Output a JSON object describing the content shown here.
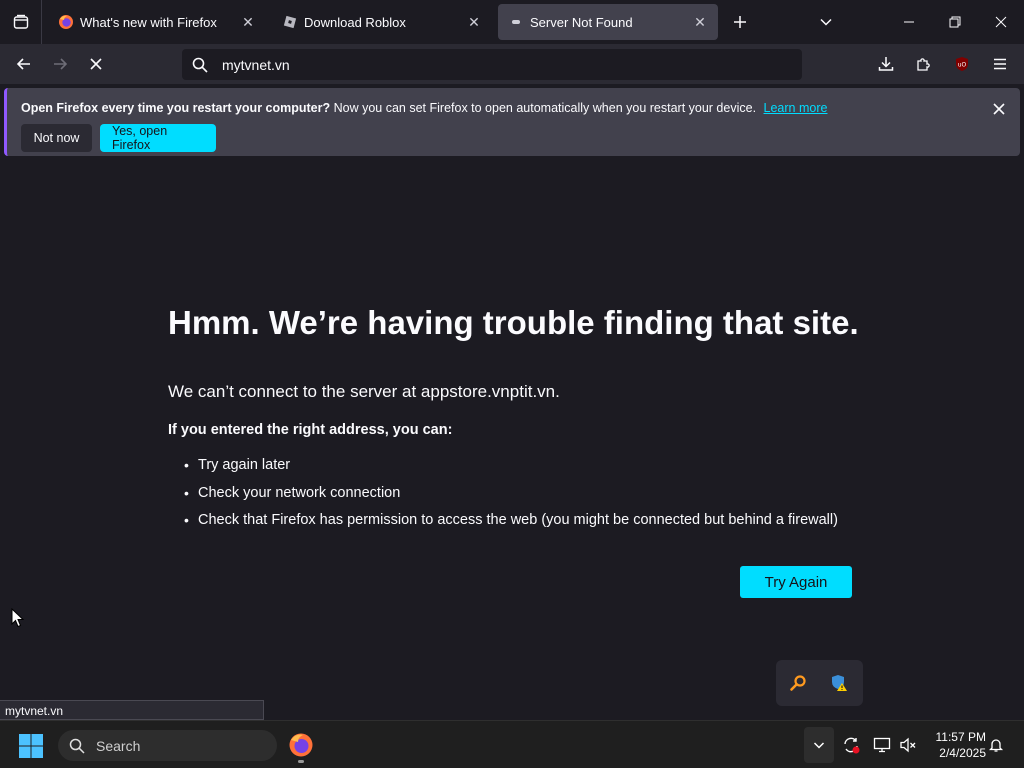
{
  "tabs": [
    {
      "title": "What's new with Firefox",
      "icon": "firefox-icon"
    },
    {
      "title": "Download Roblox",
      "icon": "roblox-icon"
    },
    {
      "title": "Server Not Found",
      "icon": "dot-icon",
      "active": true
    }
  ],
  "navbar": {
    "url": "mytvnet.vn"
  },
  "notification": {
    "bold_text": "Open Firefox every time you restart your computer?",
    "text": "Now you can set Firefox to open automatically when you restart your device.",
    "link": "Learn more",
    "secondary_button": "Not now",
    "primary_button": "Yes, open Firefox"
  },
  "error_page": {
    "title": "Hmm. We’re having trouble finding that site.",
    "description": "We can’t connect to the server at appstore.vnptit.vn.",
    "subtitle": "If you entered the right address, you can:",
    "suggestions": [
      "Try again later",
      "Check your network connection",
      "Check that Firefox has permission to access the web (you might be connected but behind a firewall)"
    ],
    "button": "Try Again"
  },
  "status_bar": {
    "text": "mytvnet.vn"
  },
  "taskbar": {
    "search_placeholder": "Search",
    "time": "11:57 PM",
    "date": "2/4/2025"
  },
  "colors": {
    "accent": "#00ddff",
    "background": "#1c1b22",
    "toolbar": "#2b2a33",
    "notification": "#42414d"
  }
}
